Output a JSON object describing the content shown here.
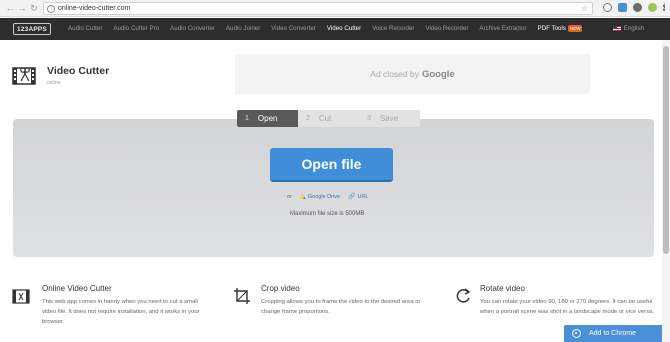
{
  "browser": {
    "url": "online-video-cutter.com",
    "back_icon": "back-arrow-icon",
    "forward_icon": "forward-arrow-icon",
    "reload_icon": "reload-icon"
  },
  "site": {
    "logo": "123APPS",
    "nav": [
      {
        "label": "Audio Cutter"
      },
      {
        "label": "Audio Cutter Pro"
      },
      {
        "label": "Audio Converter"
      },
      {
        "label": "Audio Joiner"
      },
      {
        "label": "Video Converter"
      },
      {
        "label": "Video Cutter",
        "active": true
      },
      {
        "label": "Voice Recorder"
      },
      {
        "label": "Video Recorder"
      },
      {
        "label": "Archive Extractor"
      },
      {
        "label": "PDF Tools",
        "badge": "NEW"
      }
    ],
    "language": "English"
  },
  "app": {
    "title": "Video Cutter",
    "subtitle": "online"
  },
  "ad": {
    "text": "Ad closed by",
    "brand": "Google"
  },
  "steps": [
    {
      "num": "1",
      "label": "Open",
      "active": true
    },
    {
      "num": "2",
      "label": "Cut"
    },
    {
      "num": "3",
      "label": "Save"
    }
  ],
  "upload": {
    "button_label": "Open file",
    "or": "or",
    "drive_label": "Google Drive",
    "url_label": "URL",
    "max_size": "Maximum file size is 500MB"
  },
  "features": [
    {
      "title": "Online Video Cutter",
      "desc": "This web app comes in handy when you need to cut a small video file. It does not require installation, and it works in your browser.",
      "icon": "film-scissors-icon"
    },
    {
      "title": "Crop video",
      "desc": "Cropping allows you to frame the video to the desired area or change frame proportions.",
      "icon": "crop-icon"
    },
    {
      "title": "Rotate video",
      "desc": "You can rotate your video 90, 180 or 270 degrees. It can be useful when a portrait scene was shot in a landscape mode or vice versa.",
      "icon": "rotate-icon"
    }
  ],
  "chrome_cta": "Add to Chrome",
  "colors": {
    "nav_bg": "#2d2d2d",
    "accent": "#3e8ed8",
    "badge": "#e2641e"
  }
}
